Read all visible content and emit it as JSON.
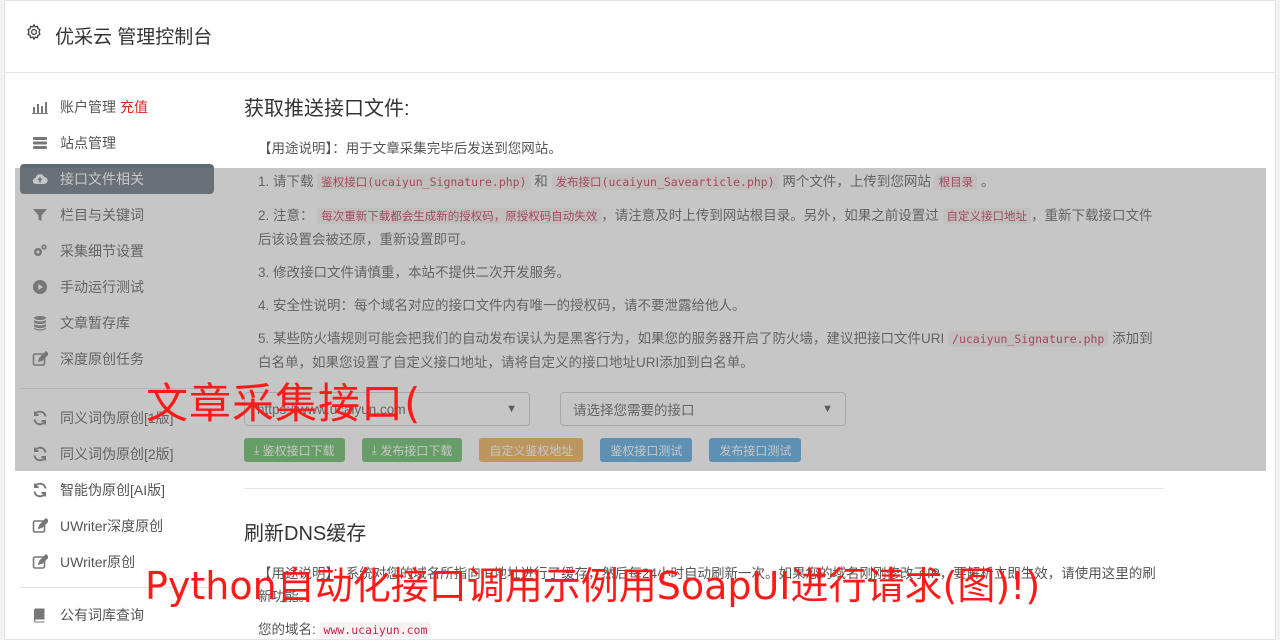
{
  "header": {
    "title": "优采云 管理控制台"
  },
  "sidebar": {
    "items": [
      {
        "label": "账户管理",
        "icon": "bar-chart-icon",
        "extra": "充值"
      },
      {
        "label": "站点管理",
        "icon": "server-icon"
      },
      {
        "label": "接口文件相关",
        "icon": "cloud-upload-icon",
        "active": true
      },
      {
        "label": "栏目与关键词",
        "icon": "filter-icon"
      },
      {
        "label": "采集细节设置",
        "icon": "gears-icon"
      },
      {
        "label": "手动运行测试",
        "icon": "play-icon"
      },
      {
        "label": "文章暂存库",
        "icon": "database-icon"
      },
      {
        "label": "深度原创任务",
        "icon": "edit-icon"
      },
      {
        "label": "同义词伪原创[1版]",
        "icon": "refresh-icon"
      },
      {
        "label": "同义词伪原创[2版]",
        "icon": "refresh-icon"
      },
      {
        "label": "智能伪原创[AI版]",
        "icon": "refresh-icon"
      },
      {
        "label": "UWriter深度原创",
        "icon": "edit-icon"
      },
      {
        "label": "UWriter原创",
        "icon": "edit-icon"
      },
      {
        "label": "公有词库查询",
        "icon": "book-icon"
      }
    ]
  },
  "section1": {
    "title": "获取推送接口文件:",
    "usage": "【用途说明】：用于文章采集完毕后发送到您网站。",
    "item1": {
      "pre": "1. 请下载",
      "code1": "鉴权接口(ucaiyun_Signature.php)",
      "mid": "和",
      "code2": "发布接口(ucaiyun_Savearticle.php)",
      "post": "两个文件，上传到您网站",
      "code3": "根目录",
      "end": "。"
    },
    "item2": {
      "pre": "2. 注意：",
      "code1": "每次重新下载都会生成新的授权码，原授权码自动失效",
      "mid": "，请注意及时上传到网站根目录。另外，如果之前设置过",
      "code2": "自定义接口地址",
      "post": "，重新下载接口文件后该设置会被还原，重新设置即可。"
    },
    "item3": "3. 修改接口文件请慎重，本站不提供二次开发服务。",
    "item4": "4. 安全性说明：每个域名对应的接口文件内有唯一的授权码，请不要泄露给他人。",
    "item5": {
      "pre": "5. 某些防火墙规则可能会把我们的自动发布误认为是黑客行为，如果您的服务器开启了防火墙，建议把接口文件URI",
      "code1": "/ucaiyun_Signature.php",
      "post": "添加到白名单，如果您设置了自定义接口地址，请将自定义的接口地址URI添加到白名单。"
    },
    "select_site": "https://www.ucaiyun.com",
    "select_api": "请选择您需要的接口",
    "buttons": {
      "auth_download": "鉴权接口下载",
      "publish_download": "发布接口下载",
      "custom_auth": "自定义鉴权地址",
      "auth_test": "鉴权接口测试",
      "publish_test": "发布接口测试"
    }
  },
  "section2": {
    "title": "刷新DNS缓存",
    "usage": "【用途说明】：系统对您的域名所指向IP地址进行了缓存，然后每24小时自动刷新一次。如果您的域名刚刚修改了IP，要解析立即生效，请使用这里的刷新功能。",
    "domain_label": "您的域名:",
    "domain_value": "www.ucaiyun.com"
  },
  "watermark": {
    "line1": "文章采集接口(",
    "line2": "Python自动化接口调用示例用SoapUI进行请求(图)!)"
  }
}
